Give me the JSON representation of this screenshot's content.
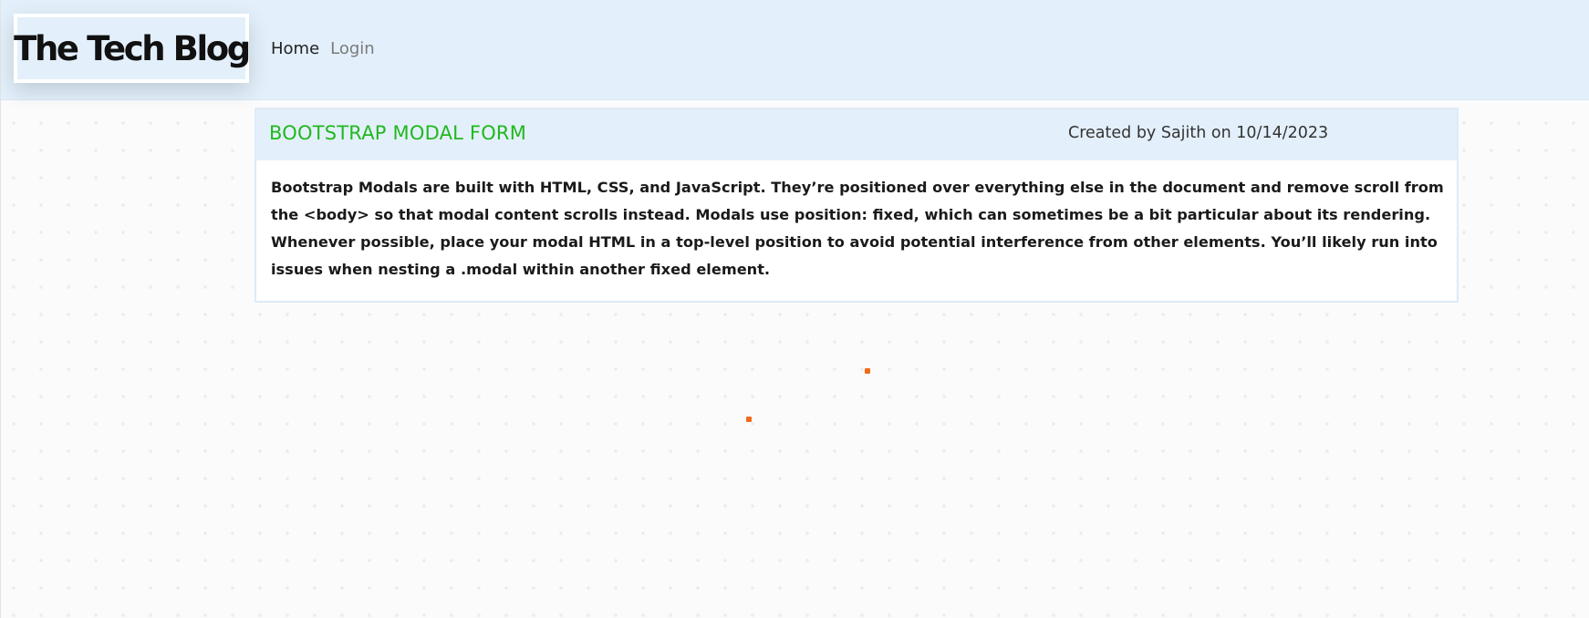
{
  "header": {
    "brand": "The Tech Blog",
    "nav": {
      "home_label": "Home",
      "login_label": "Login"
    }
  },
  "post": {
    "title": "BOOTSTRAP MODAL FORM",
    "meta": "Created by Sajith on 10/14/2023",
    "body": "Bootstrap Modals are built with HTML, CSS, and JavaScript. They’re positioned over everything else in the document and remove scroll from the <body> so that modal content scrolls instead. Modals use position: fixed, which can sometimes be a bit particular about its rendering. Whenever possible, place your modal HTML in a top-level position to avoid potential interference from other elements. You’ll likely run into issues when nesting a .modal within another fixed element."
  },
  "colors": {
    "navbar_bg": "#e3f0fb",
    "title_green": "#22b81f",
    "accent_dot": "#f26a1b"
  }
}
